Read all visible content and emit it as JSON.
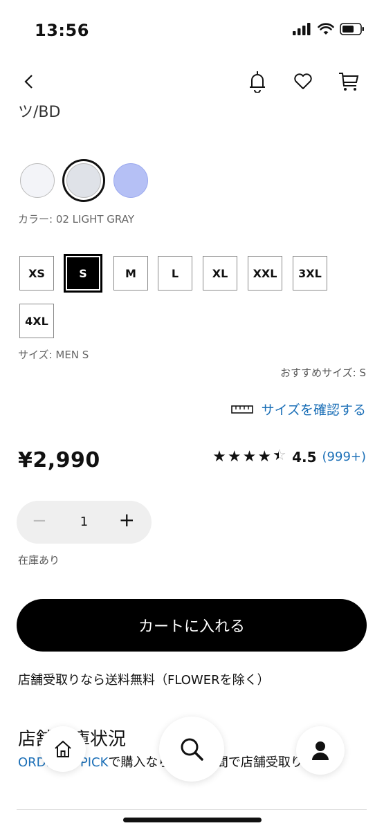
{
  "status_bar": {
    "time": "13:56"
  },
  "product": {
    "title_fragment": "ツ/BD"
  },
  "colors": {
    "label": "カラー: 02 LIGHT GRAY",
    "swatches": [
      {
        "name": "white",
        "hex": "#f3f4f8"
      },
      {
        "name": "light-gray",
        "hex": "#dfe2e8",
        "selected": true
      },
      {
        "name": "blue",
        "hex": "#b5c0f5"
      }
    ]
  },
  "sizes": {
    "options": [
      "XS",
      "S",
      "M",
      "L",
      "XL",
      "XXL",
      "3XL",
      "4XL"
    ],
    "selected": "S",
    "label": "サイズ: MEN S",
    "recommended": "おすすめサイズ: S",
    "check_link": "サイズを確認する"
  },
  "price": "¥2,990",
  "rating": {
    "value": "4.5",
    "count": "(999+)",
    "stars": 4.5
  },
  "quantity": {
    "minus": "−",
    "value": "1",
    "plus": "+"
  },
  "stock": "在庫あり",
  "cart_button": "カートに入れる",
  "store_pickup_note": "店舗受取りなら送料無料（FLOWERを除く）",
  "store_stock": {
    "title": "店舗在庫状況",
    "link_text": "ORDER & PICK",
    "text": "で購入なら最短1時間で店舗受取り"
  },
  "accent_color": "#1b6fb7",
  "icons": [
    "back-icon",
    "bell-icon",
    "heart-icon",
    "cart-icon",
    "ruler-icon",
    "home-icon",
    "search-icon",
    "account-icon"
  ]
}
